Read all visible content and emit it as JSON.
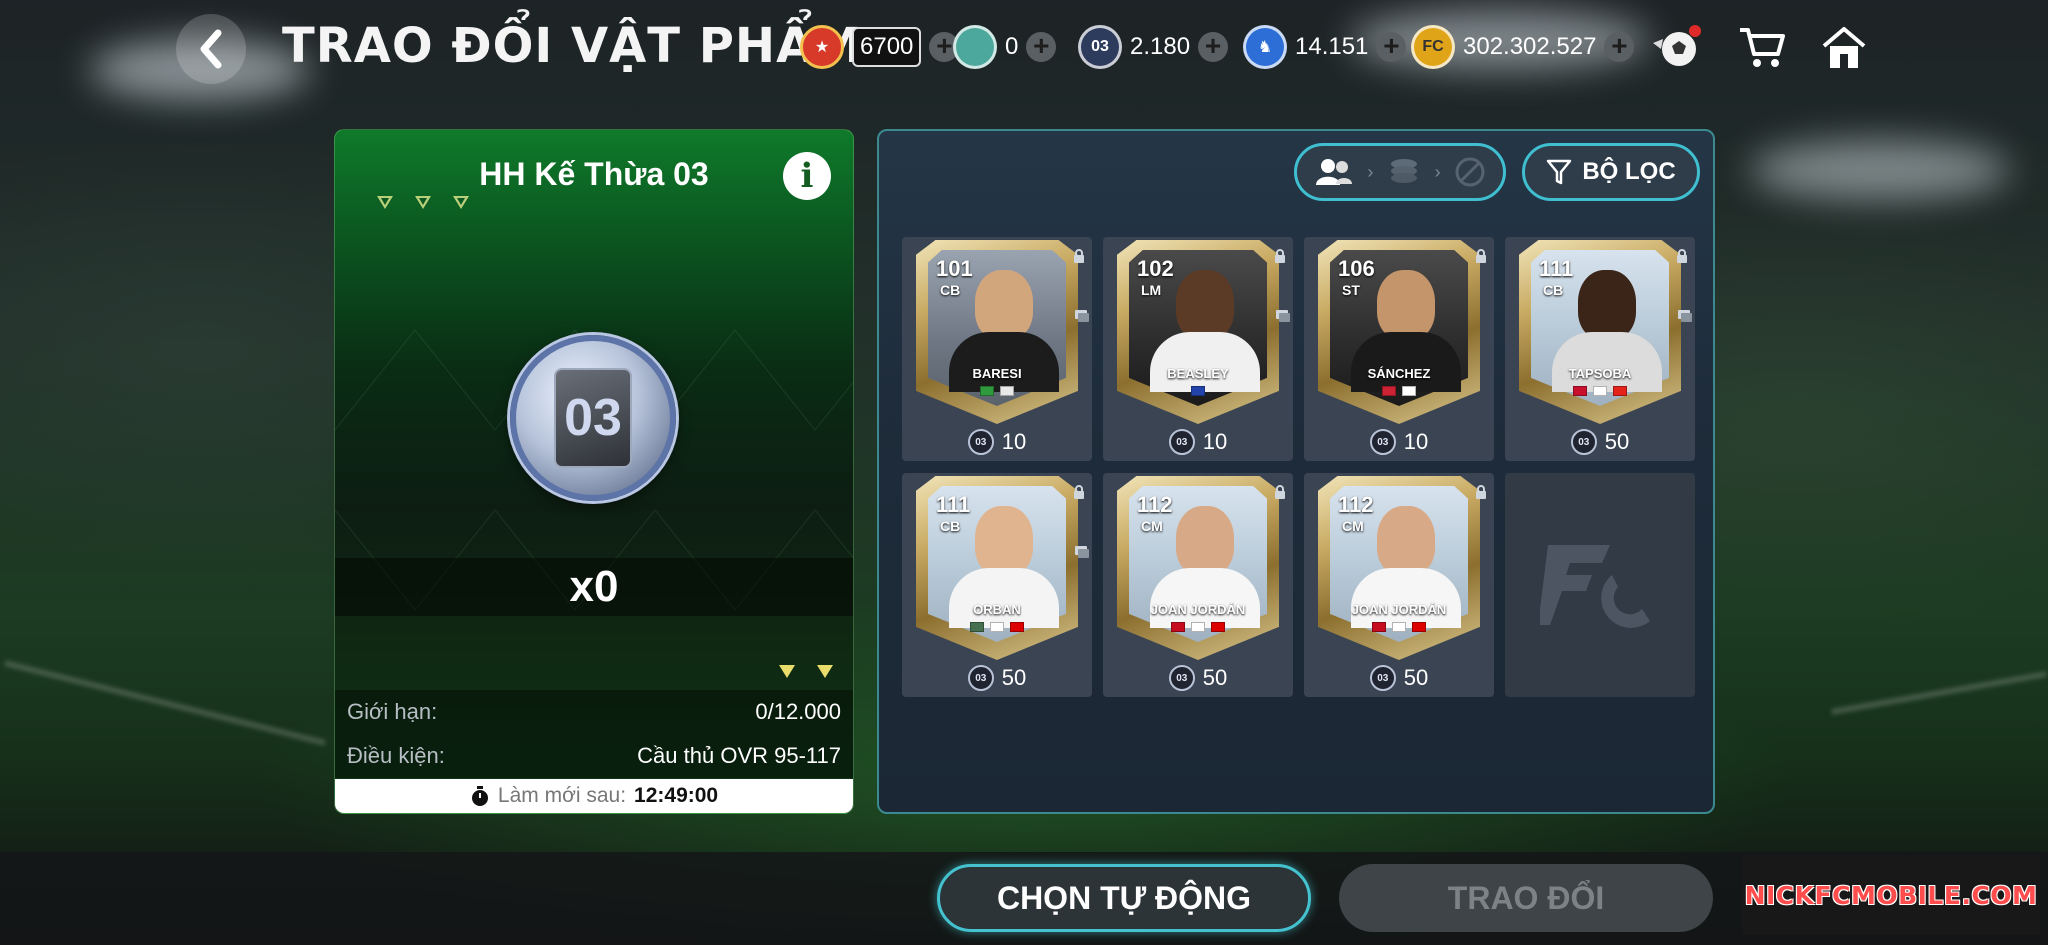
{
  "header": {
    "title": "TRAO ĐỔI VẬT PHẨM",
    "currencies": [
      {
        "icon": "event-coin-icon",
        "value": "6700",
        "color": "#d83a2a"
      },
      {
        "icon": "shield-gem-icon",
        "value": "0",
        "color": "#7fd3c9"
      },
      {
        "icon": "token-03-icon",
        "value": "2.180",
        "color": "#2d3b5c"
      },
      {
        "icon": "runner-coin-icon",
        "value": "14.151",
        "color": "#2d6ed6"
      },
      {
        "icon": "fc-coin-icon",
        "value": "302.302.527",
        "color": "#e0a419"
      }
    ],
    "icons": [
      "ball-icon",
      "cart-icon",
      "home-icon"
    ]
  },
  "left_panel": {
    "title": "HH Kế Thừa 03",
    "token_label": "03",
    "count": "x0",
    "limit_label": "Giới hạn:",
    "limit_value": "0/12.000",
    "condition_label": "Điều kiện:",
    "condition_value": "Cầu thủ OVR 95-117",
    "refresh_label": "Làm mới sau:",
    "refresh_time": "12:49:00"
  },
  "right_panel": {
    "filter_label": "BỘ LỌC",
    "cards": [
      {
        "ovr": "101",
        "pos": "CB",
        "name": "BARESI",
        "price": "10",
        "style": "bw",
        "flags": [
          "#2f9a3d",
          "#e8e8e8"
        ]
      },
      {
        "ovr": "102",
        "pos": "LM",
        "name": "BEASLEY",
        "price": "10",
        "style": "dark",
        "flags": [
          "#2244aa"
        ]
      },
      {
        "ovr": "106",
        "pos": "ST",
        "name": "SÁNCHEZ",
        "price": "10",
        "style": "dark",
        "flags": [
          "#cc2233",
          "#ffffff"
        ]
      },
      {
        "ovr": "111",
        "pos": "CB",
        "name": "TAPSOBA",
        "price": "50",
        "style": "light",
        "flags": [
          "#c8102e",
          "#ffffff",
          "#e32219"
        ]
      },
      {
        "ovr": "111",
        "pos": "CB",
        "name": "ORBAN",
        "price": "50",
        "style": "light",
        "flags": [
          "#477050",
          "#ffffff",
          "#dd0000"
        ]
      },
      {
        "ovr": "112",
        "pos": "CM",
        "name": "JOAN JORDÁN",
        "price": "50",
        "style": "light",
        "flags": [
          "#c60b1e",
          "#ffffff",
          "#dd0000"
        ]
      },
      {
        "ovr": "112",
        "pos": "CM",
        "name": "JOAN JORDÁN",
        "price": "50",
        "style": "light",
        "flags": [
          "#c60b1e",
          "#ffffff",
          "#dd0000"
        ]
      }
    ],
    "token_label": "03"
  },
  "footer": {
    "auto_label": "CHỌN TỰ ĐỘNG",
    "trade_label": "TRAO ĐỔI",
    "watermark": "NICKFCMOBILE.COM"
  }
}
